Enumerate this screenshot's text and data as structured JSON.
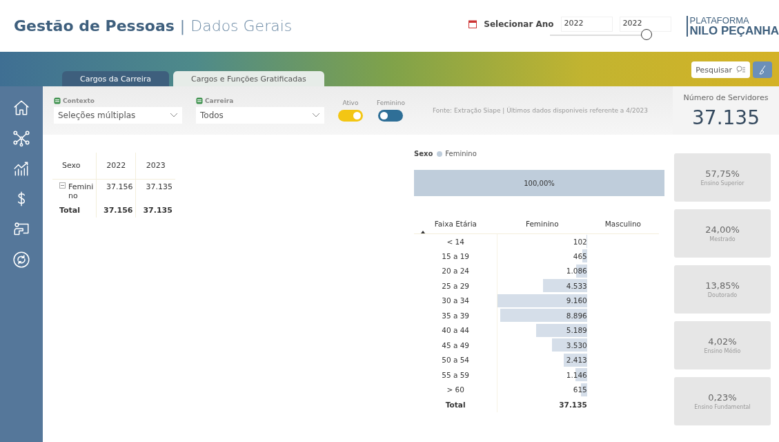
{
  "header": {
    "title": "Gestão de Pessoas",
    "separator": "|",
    "subtitle": "Dados Gerais",
    "year_picker": {
      "label": "Selecionar Ano",
      "from": "2022",
      "to": "2022",
      "level": 1
    },
    "logo": {
      "line1": "PLATAFORMA",
      "line2": "NILO PEÇANHA"
    }
  },
  "search": {
    "placeholder": "Pesquisar"
  },
  "tabs": [
    {
      "label": "Cargos da Carreira",
      "selected": true
    },
    {
      "label": "Cargos e Funções Gratificadas",
      "selected": false
    }
  ],
  "sidebar": {
    "items": [
      {
        "kind": "home"
      },
      {
        "kind": "network"
      },
      {
        "kind": "growth"
      },
      {
        "kind": "money"
      },
      {
        "kind": "teacher"
      },
      {
        "kind": "cycle"
      }
    ]
  },
  "filters": {
    "dropdowns": [
      {
        "label": "Contexto",
        "value": "Seleções múltiplas"
      },
      {
        "label": "Carreira",
        "value": "Todos"
      }
    ],
    "toggles": [
      {
        "label": "Ativo",
        "on": true
      },
      {
        "label": "Feminino",
        "on": false
      }
    ],
    "source": "Fonte: Extração Siape | Últimos dados disponiveis referente a 4/2023"
  },
  "kpi": {
    "label": "Número de Servidores",
    "value": "37.135"
  },
  "matrix": {
    "columns": [
      "Sexo",
      "2022",
      "2023"
    ],
    "rows": [
      {
        "label": "Femini no",
        "values": [
          "37.156",
          "37.135"
        ]
      }
    ],
    "total": {
      "label": "Total",
      "values": [
        "37.156",
        "37.135"
      ]
    }
  },
  "sex_chart": {
    "title": "Sexo",
    "legend": [
      {
        "label": "Feminino",
        "color": "#bfcddb"
      }
    ],
    "bars": [
      {
        "label": "100,00%"
      }
    ]
  },
  "age_table": {
    "columns": [
      "Faixa Etária",
      "Feminino",
      "Masculino"
    ],
    "rows": [
      {
        "range": "< 14",
        "value": "102",
        "level": 0.01
      },
      {
        "range": "15 a 19",
        "value": "465",
        "level": 0.05
      },
      {
        "range": "20 a 24",
        "value": "1.086",
        "level": 0.12
      },
      {
        "range": "25 a 29",
        "value": "4.533",
        "level": 0.49
      },
      {
        "range": "30 a 34",
        "value": "9.160",
        "level": 1
      },
      {
        "range": "35 a 39",
        "value": "8.896",
        "level": 0.97
      },
      {
        "range": "40 a 44",
        "value": "5.189",
        "level": 0.57
      },
      {
        "range": "45 a 49",
        "value": "3.530",
        "level": 0.39
      },
      {
        "range": "50 a 54",
        "value": "2.413",
        "level": 0.26
      },
      {
        "range": "55 a 59",
        "value": "1.146",
        "level": 0.13
      },
      {
        "range": "> 60",
        "value": "615",
        "level": 0.07
      }
    ],
    "total": {
      "label": "Total",
      "value": "37.135"
    }
  },
  "education_cards": [
    {
      "value": "57,75%",
      "label": "Ensino Superior"
    },
    {
      "value": "24,00%",
      "label": "Mestrado"
    },
    {
      "value": "13,85%",
      "label": "Doutorado"
    },
    {
      "value": "4,02%",
      "label": "Ensino Médio"
    },
    {
      "value": "0,23%",
      "label": "Ensino Fundamental"
    }
  ]
}
